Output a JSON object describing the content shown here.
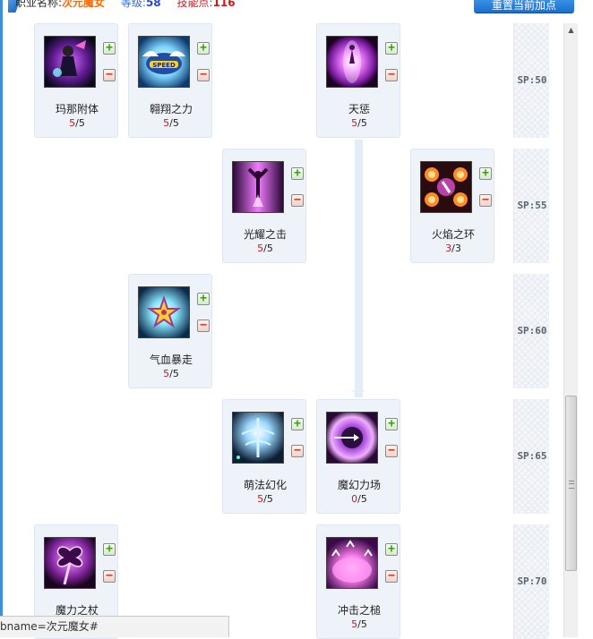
{
  "header": {
    "job_label": "职业名称:",
    "job_name": "次元魔女",
    "level_label": "等级:",
    "level_value": "58",
    "points_label": "技能点:",
    "points_value": "116",
    "reset_button": "重置当前加点"
  },
  "sp_levels": [
    "SP:50",
    "SP:55",
    "SP:60",
    "SP:65",
    "SP:70"
  ],
  "skills": [
    {
      "name": "玛那附体",
      "current": "5",
      "max": "/5",
      "icon": "mana-possession-icon"
    },
    {
      "name": "翱翔之力",
      "current": "5",
      "max": "/5",
      "icon": "speed-wings-icon"
    },
    {
      "name": "天惩",
      "current": "5",
      "max": "/5",
      "icon": "heaven-punish-icon"
    },
    {
      "name": "光耀之击",
      "current": "5",
      "max": "/5",
      "icon": "radiant-strike-icon"
    },
    {
      "name": "火焰之环",
      "current": "3",
      "max": "/3",
      "icon": "flame-ring-icon"
    },
    {
      "name": "气血暴走",
      "current": "5",
      "max": "/5",
      "icon": "blood-rampage-icon"
    },
    {
      "name": "萌法幻化",
      "current": "5",
      "max": "/5",
      "icon": "cute-magic-icon"
    },
    {
      "name": "魔幻力场",
      "current": "0",
      "max": "/5",
      "icon": "magic-field-icon"
    },
    {
      "name": "魔力之杖",
      "current": "",
      "max": "",
      "icon": "magic-staff-icon"
    },
    {
      "name": "冲击之槌",
      "current": "5",
      "max": "/5",
      "icon": "impact-hammer-icon"
    }
  ],
  "controls": {
    "plus": "+",
    "minus": "−"
  },
  "status_bar": "bname=次元魔女#",
  "colors": {
    "accent": "#3d8fd8",
    "current_level": "#c81a1a",
    "card_bg": "#eef3fa"
  }
}
